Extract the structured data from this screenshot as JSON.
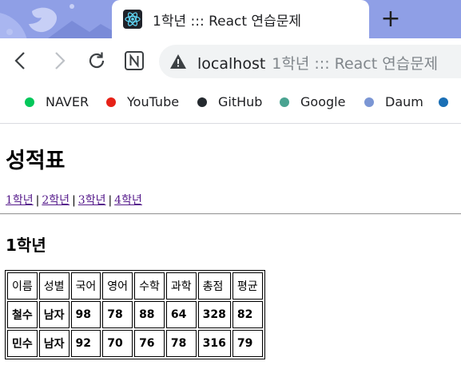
{
  "browser": {
    "tab": {
      "title": "1학년 ::: React 연습문제"
    },
    "new_tab_label": "+",
    "address_bar": {
      "host": "localhost",
      "page_title": "1학년 ::: React 연습문제"
    },
    "bookmarks": [
      {
        "label": "NAVER",
        "color": "#03c75a"
      },
      {
        "label": "YouTube",
        "color": "#e62117"
      },
      {
        "label": "GitHub",
        "color": "#24292e"
      },
      {
        "label": "Google",
        "color": "#4aa391"
      },
      {
        "label": "Daum",
        "color": "#7b96d4"
      }
    ],
    "theme_color": "#8f9fe6"
  },
  "page": {
    "title": "성적표",
    "grade_links": [
      "1학년",
      "2학년",
      "3학년",
      "4학년"
    ],
    "separator": "|",
    "section_title": "1학년",
    "table": {
      "headers": [
        "이름",
        "성별",
        "국어",
        "영어",
        "수학",
        "과학",
        "총점",
        "평균"
      ],
      "rows": [
        [
          "철수",
          "남자",
          "98",
          "78",
          "88",
          "64",
          "328",
          "82"
        ],
        [
          "민수",
          "남자",
          "92",
          "70",
          "76",
          "78",
          "316",
          "79"
        ]
      ]
    }
  }
}
